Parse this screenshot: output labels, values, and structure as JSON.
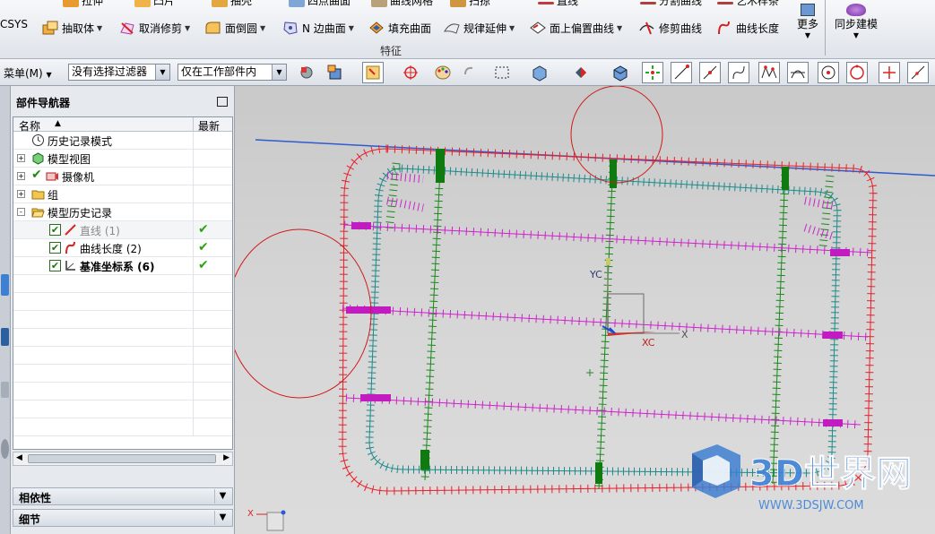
{
  "ribbon": {
    "top_row": [
      "拉伸",
      "凸片",
      "抽壳",
      "四点曲面",
      "曲线网格",
      "扫掠",
      "直线",
      "分割曲线",
      "艺术样条"
    ],
    "commands": [
      {
        "label": "抽取体",
        "icon": "extract-body-icon"
      },
      {
        "label": "取消修剪",
        "icon": "untrim-icon"
      },
      {
        "label": "面倒圆",
        "icon": "face-blend-icon"
      },
      {
        "label": "N 边曲面",
        "icon": "n-sided-surface-icon"
      },
      {
        "label": "填充曲面",
        "icon": "fill-surface-icon"
      },
      {
        "label": "规律延伸",
        "icon": "law-extension-icon"
      },
      {
        "label": "面上偏置曲线",
        "icon": "offset-curve-in-face-icon"
      },
      {
        "label": "修剪曲线",
        "icon": "trim-curve-icon"
      },
      {
        "label": "曲线长度",
        "icon": "curve-length-icon"
      }
    ],
    "csys_label": "CSYS",
    "group_label": "特征",
    "more_label": "更多",
    "sync_label": "同步建模"
  },
  "toolbar": {
    "menu_label": "菜单(M)",
    "filter_value": "没有选择过滤器",
    "scope_value": "仅在工作部件内"
  },
  "navigator": {
    "title": "部件导航器",
    "col_name": "名称",
    "col_latest": "最新",
    "rows": [
      {
        "label": "历史记录模式",
        "icon": "clock-icon",
        "expander": "",
        "checked": false,
        "latest": false,
        "dim": false,
        "bold": false
      },
      {
        "label": "模型视图",
        "icon": "model-view-icon",
        "expander": "+",
        "checked": false,
        "latest": false,
        "dim": false,
        "bold": false
      },
      {
        "label": "摄像机",
        "icon": "camera-icon",
        "expander": "+",
        "checked": false,
        "latest": false,
        "dim": false,
        "bold": false
      },
      {
        "label": "组",
        "icon": "folder-icon",
        "expander": "+",
        "checked": false,
        "latest": false,
        "dim": false,
        "bold": false
      },
      {
        "label": "模型历史记录",
        "icon": "folder-open-icon",
        "expander": "-",
        "checked": false,
        "latest": false,
        "dim": false,
        "bold": false
      },
      {
        "label": "直线 (1)",
        "icon": "line-feature-icon",
        "expander": "",
        "checked": true,
        "latest": true,
        "dim": true,
        "bold": false
      },
      {
        "label": "曲线长度 (2)",
        "icon": "curve-length-feature-icon",
        "expander": "",
        "checked": true,
        "latest": true,
        "dim": false,
        "bold": false
      },
      {
        "label": "基准坐标系 (6)",
        "icon": "datum-csys-icon",
        "expander": "",
        "checked": true,
        "latest": true,
        "dim": false,
        "bold": true
      }
    ],
    "panel_dependencies": "相依性",
    "panel_details": "细节"
  },
  "viewport": {
    "axis_x": "XC",
    "axis_y": "YC",
    "axis_x_short": "X",
    "triad_x": "X"
  },
  "watermark": {
    "title": "3D世界网",
    "url": "WWW.3DSJW.COM"
  },
  "colors": {
    "outer_curve": "#e8202a",
    "inner_curve": "#1f8a8a",
    "vertical_curve": "#1a8a1a",
    "horizontal_curve": "#cc22cc",
    "annotation": "#d01818"
  }
}
